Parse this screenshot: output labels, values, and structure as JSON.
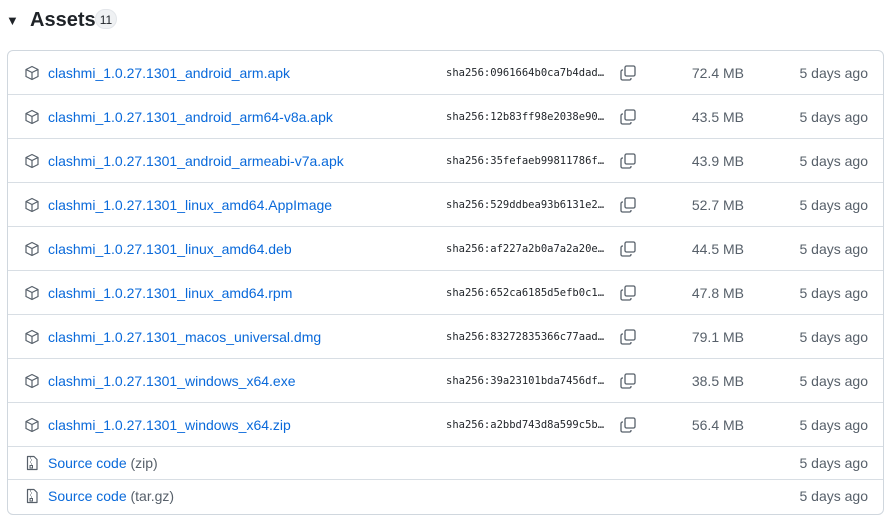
{
  "header": {
    "caret_icon": "triangle-down-icon",
    "title": "Assets",
    "count": "11"
  },
  "colors": {
    "link": "#0969da",
    "muted": "#57606a",
    "border": "#d0d7de"
  },
  "assets": [
    {
      "name": "clashmi_1.0.27.1301_android_arm.apk",
      "sha": "sha256:0961664b0ca7b4dad…",
      "size": "72.4 MB",
      "date": "5 days ago"
    },
    {
      "name": "clashmi_1.0.27.1301_android_arm64-v8a.apk",
      "sha": "sha256:12b83ff98e2038e90…",
      "size": "43.5 MB",
      "date": "5 days ago"
    },
    {
      "name": "clashmi_1.0.27.1301_android_armeabi-v7a.apk",
      "sha": "sha256:35fefaeb99811786f…",
      "size": "43.9 MB",
      "date": "5 days ago"
    },
    {
      "name": "clashmi_1.0.27.1301_linux_amd64.AppImage",
      "sha": "sha256:529ddbea93b6131e2…",
      "size": "52.7 MB",
      "date": "5 days ago"
    },
    {
      "name": "clashmi_1.0.27.1301_linux_amd64.deb",
      "sha": "sha256:af227a2b0a7a2a20e…",
      "size": "44.5 MB",
      "date": "5 days ago"
    },
    {
      "name": "clashmi_1.0.27.1301_linux_amd64.rpm",
      "sha": "sha256:652ca6185d5efb0c1…",
      "size": "47.8 MB",
      "date": "5 days ago"
    },
    {
      "name": "clashmi_1.0.27.1301_macos_universal.dmg",
      "sha": "sha256:83272835366c77aad…",
      "size": "79.1 MB",
      "date": "5 days ago"
    },
    {
      "name": "clashmi_1.0.27.1301_windows_x64.exe",
      "sha": "sha256:39a23101bda7456df…",
      "size": "38.5 MB",
      "date": "5 days ago"
    },
    {
      "name": "clashmi_1.0.27.1301_windows_x64.zip",
      "sha": "sha256:a2bbd743d8a599c5b…",
      "size": "56.4 MB",
      "date": "5 days ago"
    }
  ],
  "source_code": [
    {
      "label": "Source code",
      "format": "(zip)",
      "date": "5 days ago",
      "icon": "file-zip-icon"
    },
    {
      "label": "Source code",
      "format": "(tar.gz)",
      "date": "5 days ago",
      "icon": "file-zip-icon"
    }
  ],
  "icons": {
    "asset": "package-icon",
    "copy": "copy-icon"
  }
}
